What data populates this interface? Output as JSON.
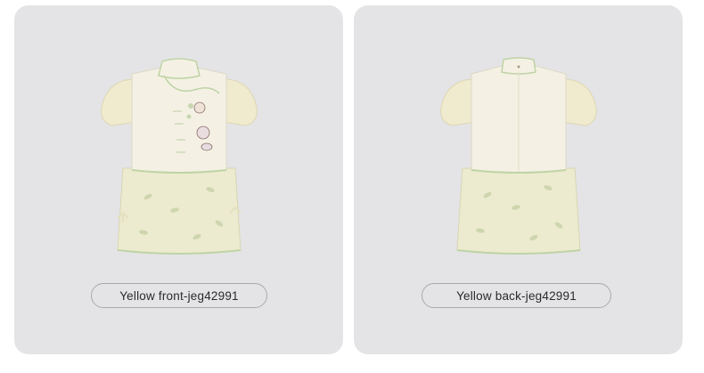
{
  "variants": [
    {
      "label": "Yellow front-jeg42991",
      "view": "front"
    },
    {
      "label": "Yellow back-jeg42991",
      "view": "back"
    }
  ],
  "colors": {
    "card_bg": "#e4e4e6",
    "dress_skirt": "#ecebcf",
    "dress_top": "#f4f1e4",
    "trim": "#bfd3a5",
    "sleeve": "#f0ebcf"
  }
}
